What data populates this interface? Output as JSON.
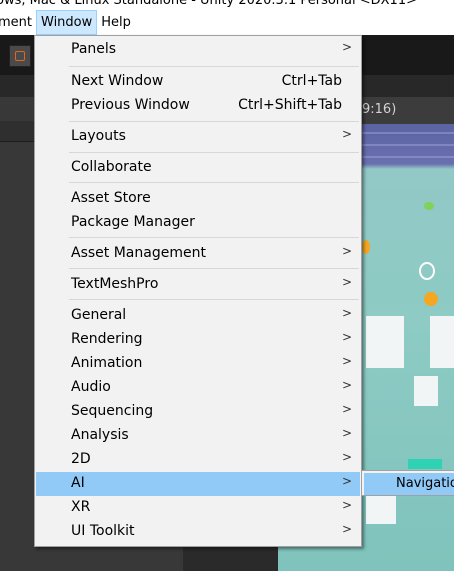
{
  "window_title": "ows, Mac & Linux Standalone - Unity 2020.3.1 Personal <DX11>",
  "menubar": {
    "items": [
      {
        "label": "ment",
        "active": false
      },
      {
        "label": "Window",
        "active": true
      },
      {
        "label": "Help",
        "active": false
      }
    ]
  },
  "game_tab_label": "9:16)",
  "window_menu": {
    "items": [
      {
        "label": "Panels",
        "shortcut": "",
        "submenu": true
      },
      {
        "label": "Next Window",
        "shortcut": "Ctrl+Tab",
        "submenu": false
      },
      {
        "label": "Previous Window",
        "shortcut": "Ctrl+Shift+Tab",
        "submenu": false
      },
      {
        "label": "Layouts",
        "shortcut": "",
        "submenu": true
      },
      {
        "label": "Collaborate",
        "shortcut": "",
        "submenu": false
      },
      {
        "label": "Asset Store",
        "shortcut": "",
        "submenu": false
      },
      {
        "label": "Package Manager",
        "shortcut": "",
        "submenu": false
      },
      {
        "label": "Asset Management",
        "shortcut": "",
        "submenu": true
      },
      {
        "label": "TextMeshPro",
        "shortcut": "",
        "submenu": true
      },
      {
        "label": "General",
        "shortcut": "",
        "submenu": true
      },
      {
        "label": "Rendering",
        "shortcut": "",
        "submenu": true
      },
      {
        "label": "Animation",
        "shortcut": "",
        "submenu": true
      },
      {
        "label": "Audio",
        "shortcut": "",
        "submenu": true
      },
      {
        "label": "Sequencing",
        "shortcut": "",
        "submenu": true
      },
      {
        "label": "Analysis",
        "shortcut": "",
        "submenu": true
      },
      {
        "label": "2D",
        "shortcut": "",
        "submenu": true
      },
      {
        "label": "AI",
        "shortcut": "",
        "submenu": true,
        "highlighted": true
      },
      {
        "label": "XR",
        "shortcut": "",
        "submenu": true
      },
      {
        "label": "UI Toolkit",
        "shortcut": "",
        "submenu": true
      }
    ],
    "submenu_arrow": ">"
  },
  "ai_submenu": {
    "items": [
      {
        "label": "Navigation"
      }
    ]
  },
  "colors": {
    "menu_highlight": "#91c9f7",
    "menubar_active": "#cce8ff",
    "menu_background": "#f2f2f2"
  }
}
